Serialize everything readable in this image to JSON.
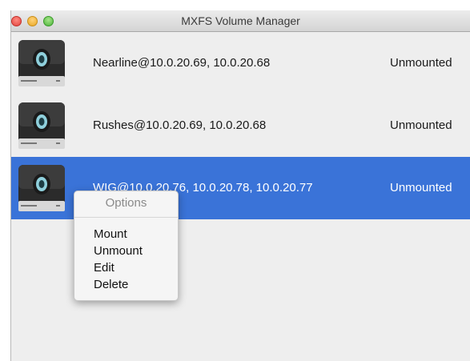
{
  "window": {
    "title": "MXFS Volume Manager"
  },
  "volumes": [
    {
      "name": "Nearline@10.0.20.69, 10.0.20.68",
      "status": "Unmounted",
      "selected": false
    },
    {
      "name": "Rushes@10.0.20.69, 10.0.20.68",
      "status": "Unmounted",
      "selected": false
    },
    {
      "name": "WIG@10.0.20.76, 10.0.20.78, 10.0.20.77",
      "status": "Unmounted",
      "selected": true
    }
  ],
  "context_menu": {
    "header": "Options",
    "items": [
      "Mount",
      "Unmount",
      "Edit",
      "Delete"
    ]
  },
  "icons": {
    "volume": "external-drive-icon"
  },
  "colors": {
    "selection": "#3a73d8",
    "window_bg": "#eeeeee"
  }
}
